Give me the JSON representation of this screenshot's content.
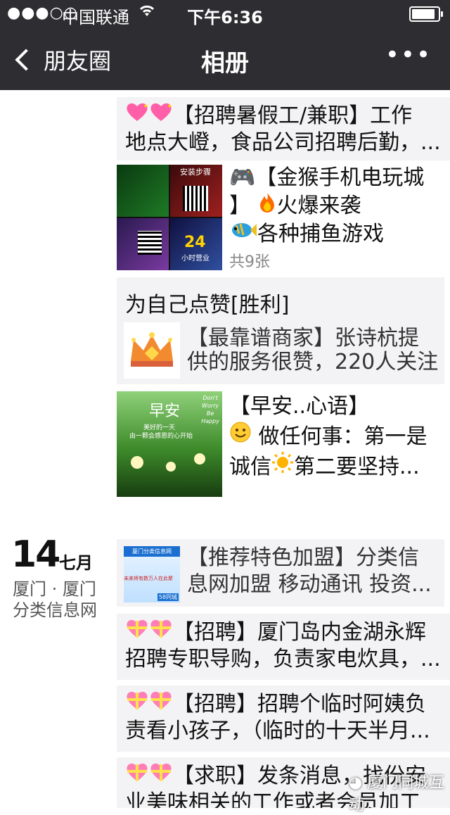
{
  "status_bar": {
    "signal": "●●●○○",
    "carrier": "中国联通",
    "time": "下午6:36",
    "battery_level": 0.9
  },
  "nav": {
    "back_label": "朋友圈",
    "title": "相册",
    "more": "•••"
  },
  "posts": {
    "p1": {
      "line1": "【招聘暑假工/兼职】工作",
      "line2": "地点大嶝，食品公司招聘后勤，..."
    },
    "p2": {
      "line1": "【金猴手机电玩城",
      "line2": "】",
      "line2b": "火爆来袭",
      "line3": "各种捕鱼游戏",
      "count": "共9张",
      "img_texts": [
        "安装步骤",
        "24",
        "小时营业"
      ]
    },
    "p3": {
      "text": "为自己点赞[胜利]",
      "share_line1": "【最靠谱商家】张诗杭提",
      "share_line2": "供的服务很赞，220人关注"
    },
    "p4": {
      "line1": "【早安..心语】",
      "line2": "做任何事：第一是",
      "line3a": "诚信",
      "line3b": "第二要坚持...",
      "img_title": "早安",
      "img_sub1": "美好的一天",
      "img_sub2": "由一颗会感恩的心开始",
      "img_side": [
        "Don't",
        "Worry",
        "Be",
        "Happy"
      ]
    },
    "p5": {
      "share_line1": "【推荐特色加盟】分类信",
      "share_line2": "息网加盟 移动通讯 投资...",
      "thumb_title": "厦门分类信息网",
      "thumb_sub": "未来将有数万人在此聚",
      "thumb_num": "58同城"
    },
    "p6": {
      "line1": "【招聘】厦门岛内金湖永辉",
      "line2": "招聘专职导购，负责家电炊具，..."
    },
    "p7": {
      "line1": "【招聘】招聘个临时阿姨负",
      "line2": "责看小孩子，（临时的十天半月..."
    },
    "p8": {
      "line1": "【求职】发条消息，",
      "line1b": "找份安",
      "line2": "业美味相关的工作或者会员加工"
    }
  },
  "date_group": {
    "day": "14",
    "month": "七月",
    "location_line1": "厦门 · 厦门",
    "location_line2": "分类信息网"
  },
  "watermark": "厦门同城互动"
}
